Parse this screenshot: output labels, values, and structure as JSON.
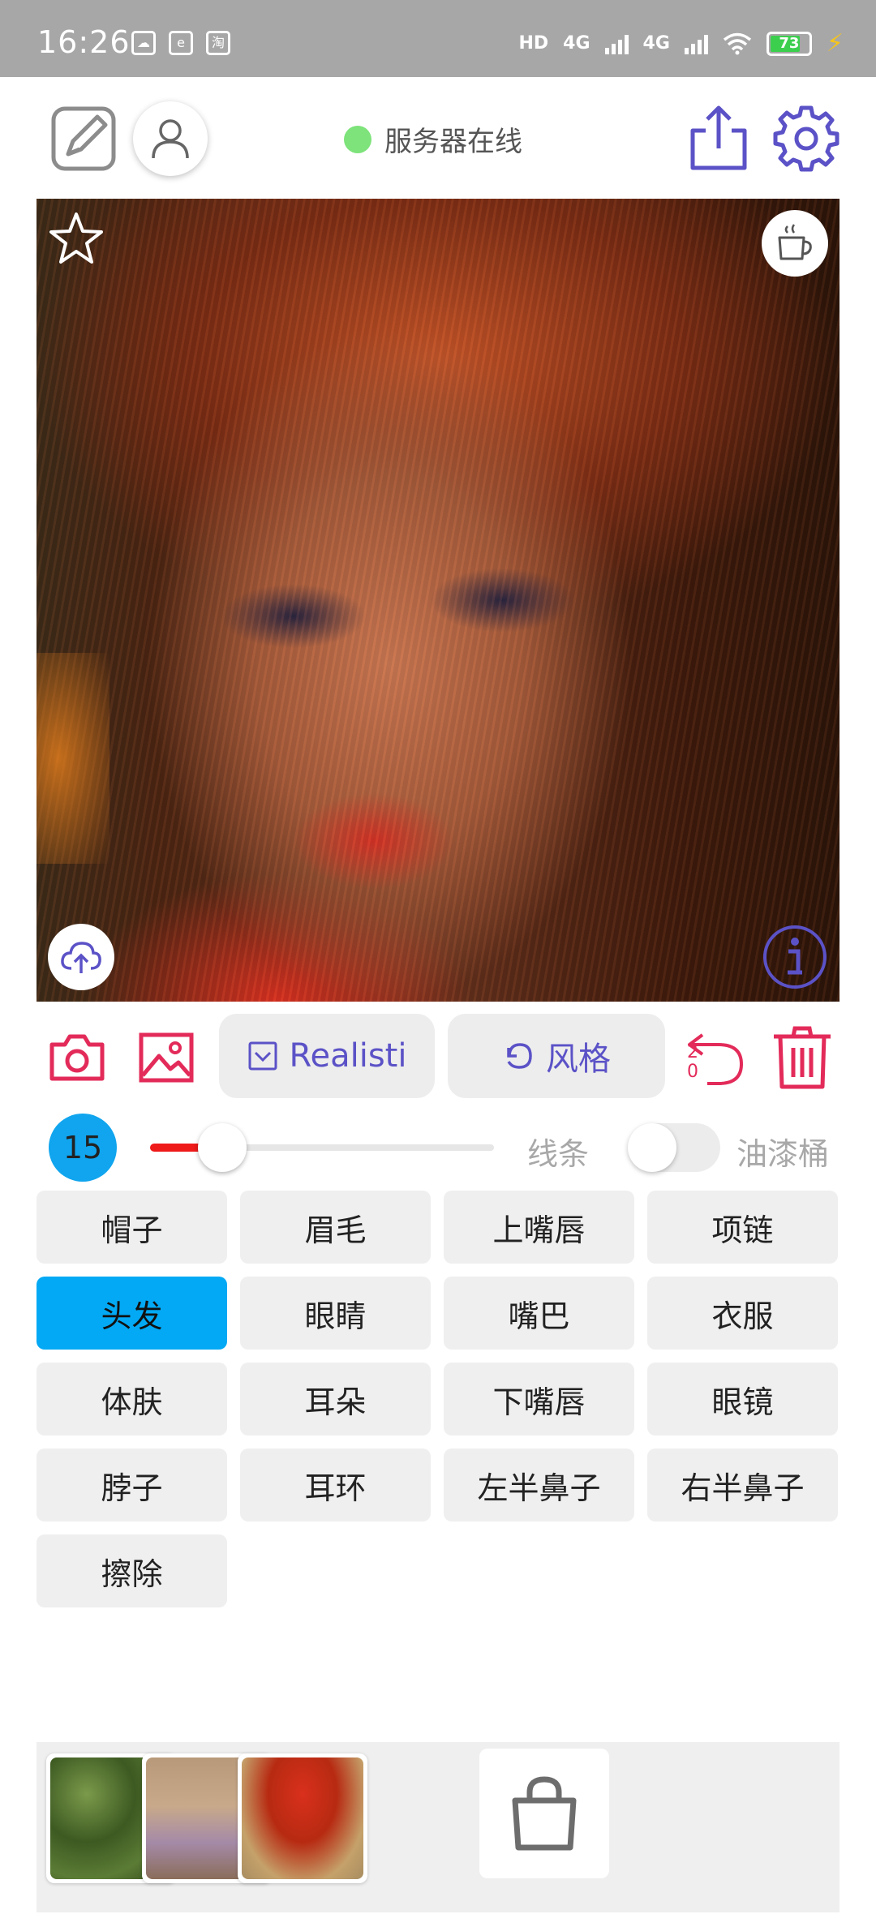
{
  "status_bar": {
    "time": "16:26",
    "notification_icons": [
      "cloud-app-icon",
      "e-app-icon",
      "taobao-icon"
    ],
    "taobao_glyph": "淘",
    "hd_label": "HD",
    "network_1": "4G",
    "network_2": "4G",
    "battery_level": "73"
  },
  "header": {
    "server_status": "服务器在线",
    "server_status_color": "#7de37a"
  },
  "toolbar": {
    "style_model_label": "Realisti",
    "style_label": "风格",
    "undo_count_top": "2",
    "undo_count_bottom": "0",
    "accent_color": "#e32b5a",
    "primary_color": "#5b52c7"
  },
  "brush": {
    "size": "15",
    "slider_fraction": 0.21,
    "lines_label": "线条",
    "bucket_label": "油漆桶",
    "bucket_enabled": false
  },
  "parts": [
    {
      "label": "帽子",
      "active": false
    },
    {
      "label": "眉毛",
      "active": false
    },
    {
      "label": "上嘴唇",
      "active": false
    },
    {
      "label": "项链",
      "active": false
    },
    {
      "label": "头发",
      "active": true
    },
    {
      "label": "眼睛",
      "active": false
    },
    {
      "label": "嘴巴",
      "active": false
    },
    {
      "label": "衣服",
      "active": false
    },
    {
      "label": "体肤",
      "active": false
    },
    {
      "label": "耳朵",
      "active": false
    },
    {
      "label": "下嘴唇",
      "active": false
    },
    {
      "label": "眼镜",
      "active": false
    },
    {
      "label": "脖子",
      "active": false
    },
    {
      "label": "耳环",
      "active": false
    },
    {
      "label": "左半鼻子",
      "active": false
    },
    {
      "label": "右半鼻子",
      "active": false
    },
    {
      "label": "擦除",
      "active": false
    }
  ],
  "active_color": "#03a9f4"
}
